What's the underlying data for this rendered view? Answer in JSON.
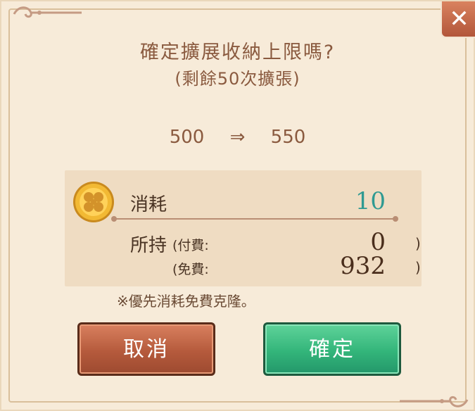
{
  "dialog": {
    "title": "確定擴展收納上限嗎?",
    "subtitle": "(剩餘50次擴張)",
    "expand": {
      "from": "500",
      "arrow": "⇒",
      "to": "550"
    },
    "cost": {
      "label": "消耗",
      "value": "10"
    },
    "owned": {
      "label": "所持",
      "paid_label": "(付費:",
      "paid_value": "0",
      "paid_close": ")",
      "free_label": "(免費:",
      "free_value": "932",
      "free_close": ")"
    },
    "note": "※優先消耗免費克隆。",
    "buttons": {
      "cancel": "取消",
      "confirm": "確定"
    },
    "close_glyph": "✕"
  },
  "icons": {
    "coin": "clover-coin-icon",
    "close": "close-icon"
  },
  "colors": {
    "text_brown": "#8a5a3f",
    "cost_value": "#2f9a92",
    "cancel_button": "#b55a3c",
    "confirm_button": "#33b57a"
  }
}
